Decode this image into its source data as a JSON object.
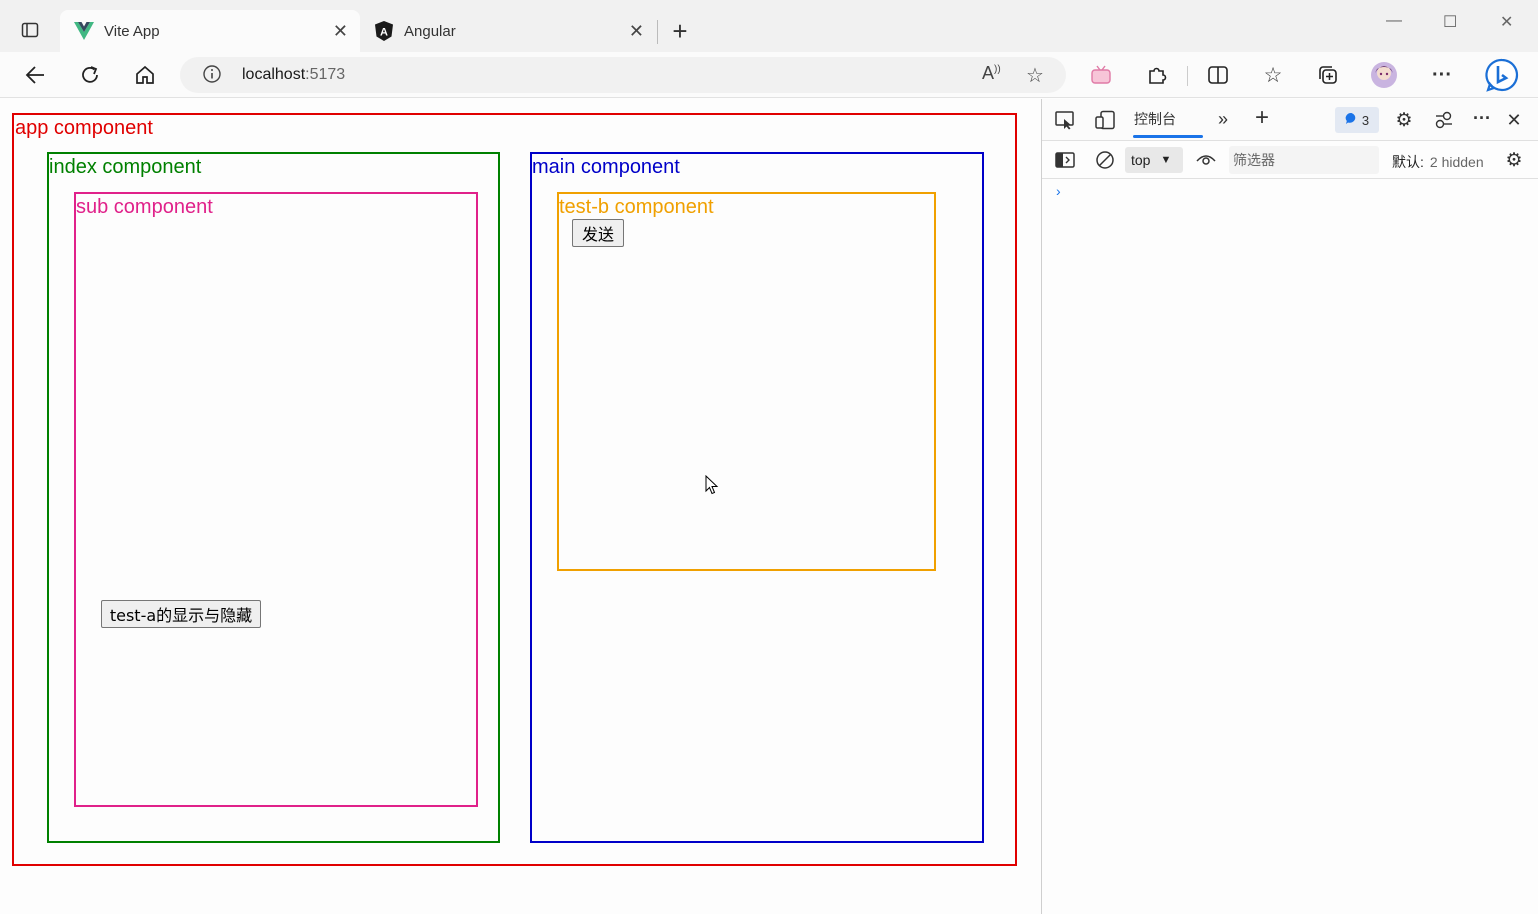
{
  "browser": {
    "tabs": [
      {
        "title": "Vite App",
        "favicon": "vue-logo-icon",
        "active": true
      },
      {
        "title": "Angular",
        "favicon": "angular-logo-icon",
        "active": false
      }
    ],
    "address": {
      "host": "localhost",
      "port": ":5173"
    }
  },
  "page": {
    "app_label": "app component",
    "index_label": "index component",
    "sub_label": "sub component",
    "toggle_button": "test-a的显示与隐藏",
    "main_label": "main component",
    "testb_label": "test-b component",
    "send_button": "发送",
    "colors": {
      "app": "#e00000",
      "index": "#008000",
      "sub": "#e0218a",
      "main": "#0000c8",
      "testb": "#f0a000"
    }
  },
  "devtools": {
    "console_tab": "控制台",
    "message_count": "3",
    "context": "top",
    "filter_placeholder": "筛选器",
    "levels_label": "默认",
    "hidden_count": "2 hidden"
  }
}
